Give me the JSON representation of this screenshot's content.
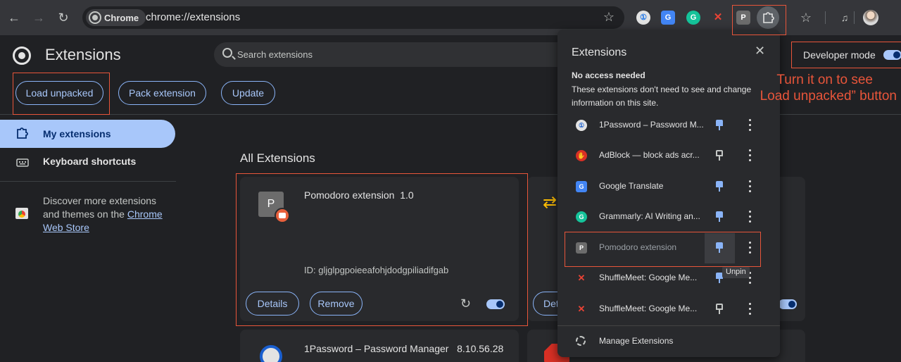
{
  "browser": {
    "chip_label": "Chrome",
    "url": "chrome://extensions",
    "buttons": {
      "back": "←",
      "forward": "→",
      "reload": "↻",
      "bookmark": "☆"
    }
  },
  "page": {
    "title": "Extensions",
    "search_placeholder": "Search extensions",
    "actions": {
      "load_unpacked": "Load unpacked",
      "pack_extension": "Pack extension",
      "update": "Update"
    },
    "developer_mode_label": "Developer mode",
    "developer_mode_on": true
  },
  "sidebar": {
    "items": [
      {
        "label": "My extensions",
        "active": true
      },
      {
        "label": "Keyboard shortcuts",
        "active": false
      }
    ],
    "discover_text": "Discover more extensions and themes on the ",
    "discover_link": "Chrome Web Store"
  },
  "main": {
    "section_title": "All Extensions",
    "cards": [
      {
        "name": "Pomodoro extension",
        "version": "1.0",
        "icon_letter": "P",
        "id_text": "ID: gljglpgpoieeafohjdodgpiliadifgab",
        "details_label": "Details",
        "remove_label": "Remove",
        "enabled": true
      },
      {
        "name": "1Password – Password Manager",
        "version": "8.10.56.28"
      }
    ],
    "partial_button": "Det"
  },
  "popup": {
    "title": "Extensions",
    "subtitle": "No access needed",
    "description": "These extensions don't need to see and change information on this site.",
    "items": [
      {
        "name": "1Password – Password M...",
        "icon": "1password-icon",
        "pinned": true
      },
      {
        "name": "AdBlock — block ads acr...",
        "icon": "adblock-icon",
        "pinned": false
      },
      {
        "name": "Google Translate",
        "icon": "google-translate-icon",
        "pinned": true
      },
      {
        "name": "Grammarly: AI Writing an...",
        "icon": "grammarly-icon",
        "pinned": true
      },
      {
        "name": "Pomodoro extension",
        "icon": "pomodoro-icon",
        "pinned": true
      },
      {
        "name": "ShuffleMeet: Google Me...",
        "icon": "shufflemeet-icon",
        "pinned": true
      },
      {
        "name": "ShuffleMeet: Google Me...",
        "icon": "shufflemeet-icon",
        "pinned": false
      }
    ],
    "manage_label": "Manage Extensions",
    "tooltip": "Unpin",
    "pomodoro_letter": "P"
  },
  "annotation": {
    "line1": "Turn it on to see",
    "line2": "Load unpacked” button"
  },
  "colors": {
    "accent": "#a8c7fa",
    "annotation": "#e8553a",
    "background": "#202124"
  }
}
